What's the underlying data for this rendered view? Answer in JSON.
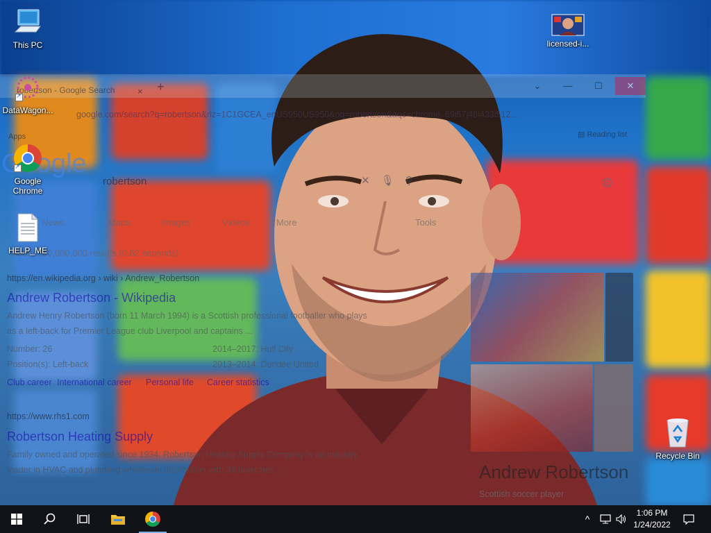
{
  "desktop": {
    "icons": [
      {
        "label": "This PC",
        "icon": "this-pc-icon"
      },
      {
        "label": "licensed-i...",
        "icon": "image-file-icon"
      },
      {
        "label": "DataWagon...",
        "icon": "datawagon-icon"
      },
      {
        "label": "Google Chrome",
        "icon": "chrome-icon"
      },
      {
        "label": "HELP_ME",
        "icon": "text-document-icon"
      },
      {
        "label": "Recycle Bin",
        "icon": "recycle-bin-icon"
      }
    ]
  },
  "browser": {
    "tab_title": "robertson - Google Search",
    "tab_close": "×",
    "new_tab": "+",
    "window_buttons": {
      "dropdown": "⌄",
      "minimize": "—",
      "maximize": "☐",
      "close": "✕"
    },
    "address": "google.com/search?q=robertson&rlz=1C1GCEA_enUS950US950&oq=robertson&aqs=chrome..69i57j46i433i512...",
    "reading_list": "Reading list",
    "bookmarks_apps": "Apps",
    "logo": "Google",
    "query": "robertson",
    "nav_tabs": [
      "News",
      "Maps",
      "Images",
      "Videos",
      "More",
      "Tools"
    ],
    "stats": "About 200,000,000 results (0.62 seconds)",
    "results": [
      {
        "url": "https://en.wikipedia.org › wiki › Andrew_Robertson",
        "title": "Andrew Robertson - Wikipedia",
        "snippet1": "Andrew Henry Robertson (born 11 March 1994) is a Scottish professional footballer who plays",
        "snippet2": "as a left-back for Premier League club Liverpool and captains ...",
        "facts": [
          {
            "left": "Number: 26",
            "right": "2014–2017: Hull City"
          },
          {
            "left": "Position(s): Left-back",
            "right": "2013–2014: Dundee United"
          }
        ],
        "links": [
          "Club career",
          "International career",
          "Personal life",
          "Career statistics"
        ]
      },
      {
        "url": "https://www.rhs1.com",
        "title": "Robertson Heating Supply",
        "snippet1": "Family owned and operated since 1934, Robertson Heating Supply Company is an industry",
        "snippet2": "leader in HVAC and plumbing wholesale distribution with 36 branches ..."
      }
    ],
    "knowledge_panel": {
      "title": "Andrew Robertson",
      "subtitle": "Scottish soccer player"
    }
  },
  "taskbar": {
    "start": "start-icon",
    "search": "search-icon",
    "task_view": "task-view-icon",
    "file_explorer": "file-explorer-icon",
    "chrome": "chrome-icon",
    "tray_chevron": "^",
    "time": "1:06 PM",
    "date": "1/24/2022"
  }
}
